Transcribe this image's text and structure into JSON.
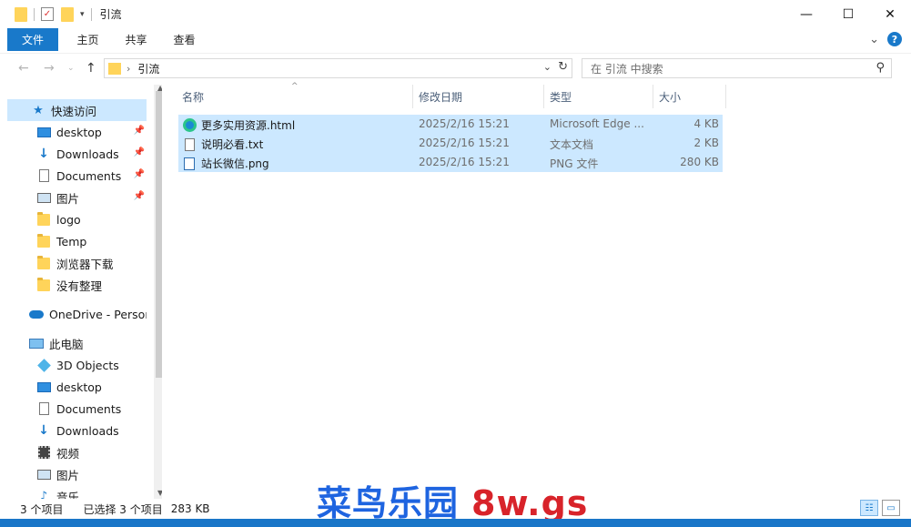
{
  "window": {
    "title": "引流",
    "controls": {
      "minimize": "—",
      "maximize": "☐",
      "close": "✕"
    }
  },
  "ribbon": {
    "file_tab": "文件",
    "tabs": [
      "主页",
      "共享",
      "查看"
    ],
    "expand_glyph": "⌄",
    "help": "?"
  },
  "address": {
    "path": "引流",
    "search_placeholder": "在 引流 中搜索"
  },
  "nav": {
    "items": [
      {
        "label": "快速访问",
        "icon": "star-icon",
        "pinned": false,
        "selected": true
      },
      {
        "label": "desktop",
        "icon": "desktop-icon",
        "pinned": true
      },
      {
        "label": "Downloads",
        "icon": "download-icon",
        "pinned": true
      },
      {
        "label": "Documents",
        "icon": "document-icon",
        "pinned": true
      },
      {
        "label": "图片",
        "icon": "pictures-icon",
        "pinned": true
      },
      {
        "label": "logo",
        "icon": "folder-icon",
        "pinned": false
      },
      {
        "label": "Temp",
        "icon": "folder-icon",
        "pinned": false
      },
      {
        "label": "浏览器下载",
        "icon": "folder-icon",
        "pinned": false
      },
      {
        "label": "没有整理",
        "icon": "folder-icon",
        "pinned": false
      },
      {
        "label": "OneDrive - Person",
        "icon": "cloud-icon",
        "pinned": false
      },
      {
        "label": "此电脑",
        "icon": "computer-icon",
        "pinned": false
      },
      {
        "label": "3D Objects",
        "icon": "cube-icon",
        "pinned": false
      },
      {
        "label": "desktop",
        "icon": "desktop-icon",
        "pinned": false
      },
      {
        "label": "Documents",
        "icon": "document-icon",
        "pinned": false
      },
      {
        "label": "Downloads",
        "icon": "download-icon",
        "pinned": false
      },
      {
        "label": "视频",
        "icon": "video-icon",
        "pinned": false
      },
      {
        "label": "图片",
        "icon": "pictures-icon",
        "pinned": false
      },
      {
        "label": "音乐",
        "icon": "music-icon",
        "pinned": false
      }
    ]
  },
  "columns": {
    "name": "名称",
    "date": "修改日期",
    "type": "类型",
    "size": "大小"
  },
  "files": [
    {
      "name": "更多实用资源.html",
      "date": "2025/2/16 15:21",
      "type": "Microsoft Edge ...",
      "size": "4 KB",
      "icon": "edge-icon"
    },
    {
      "name": "说明必看.txt",
      "date": "2025/2/16 15:21",
      "type": "文本文档",
      "size": "2 KB",
      "icon": "text-file-icon"
    },
    {
      "name": "站长微信.png",
      "date": "2025/2/16 15:21",
      "type": "PNG 文件",
      "size": "280 KB",
      "icon": "image-file-icon"
    }
  ],
  "status": {
    "count": "3 个项目",
    "selected": "已选择 3 个项目",
    "size": "283 KB"
  },
  "watermark": {
    "text": "菜鸟乐园",
    "domain": "8w.gs"
  },
  "colors": {
    "accent": "#1979ca",
    "selection": "#cce8ff",
    "folder": "#ffd45a"
  }
}
